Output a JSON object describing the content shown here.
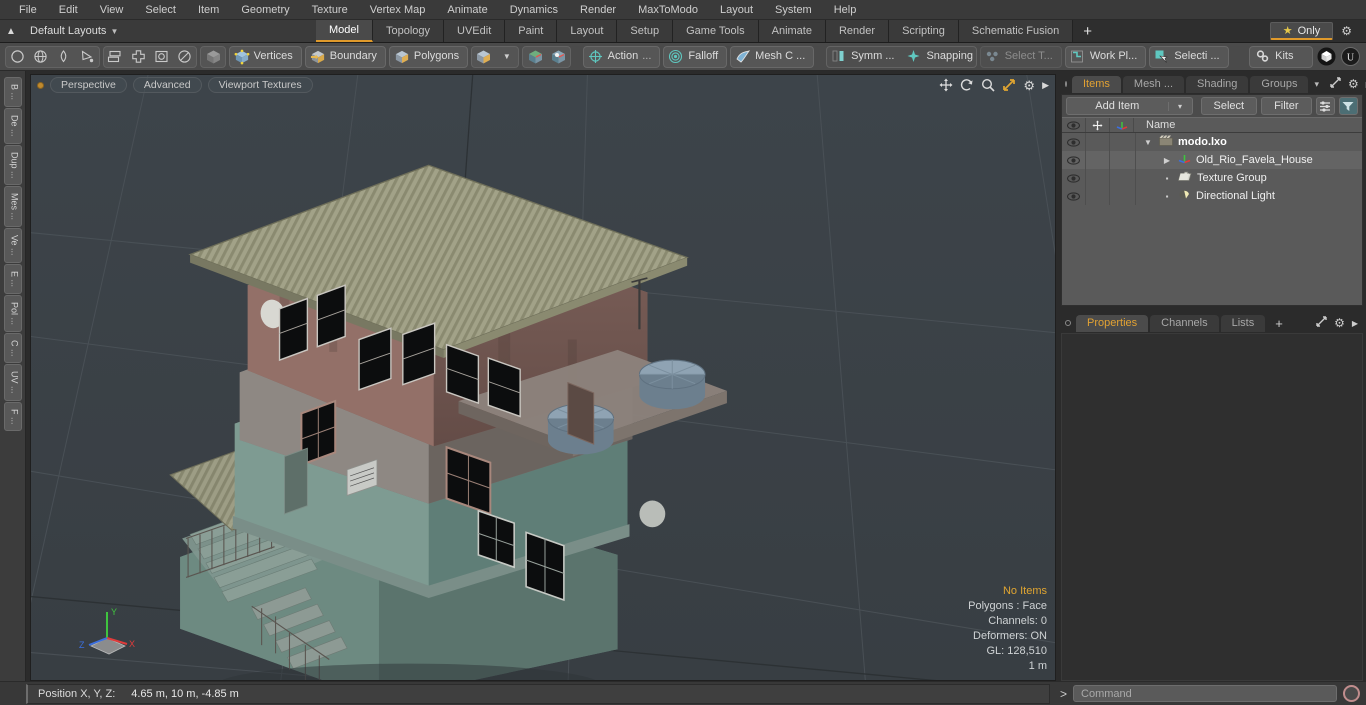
{
  "app": {
    "title": "modo",
    "accent": "#e09a2b",
    "viewport_bg": "#3b4247"
  },
  "menubar": {
    "items": [
      "File",
      "Edit",
      "View",
      "Select",
      "Item",
      "Geometry",
      "Texture",
      "Vertex Map",
      "Animate",
      "Dynamics",
      "Render",
      "MaxToModo",
      "Layout",
      "System",
      "Help"
    ]
  },
  "layoutbar": {
    "layout_name": "Default Layouts",
    "tabs": [
      "Model",
      "Topology",
      "UVEdit",
      "Paint",
      "Layout",
      "Setup",
      "Game Tools",
      "Animate",
      "Render",
      "Scripting",
      "Schematic Fusion"
    ],
    "active_tab": "Model",
    "add_tab_label": "+",
    "only_label": "Only",
    "star_icon": "star-icon",
    "gear_icon": "gear-icon"
  },
  "toolbar": {
    "shape_tools": [
      "circle-icon",
      "globe-icon",
      "pen-icon",
      "curve-icon"
    ],
    "mode_tools": [
      "mirror-icon",
      "plus-shape-icon",
      "square-select-icon",
      "circle-select-icon"
    ],
    "selection_cube": "cube-icon",
    "pills": [
      {
        "label": "Vertices",
        "icon": "vertices-cube-icon",
        "dim": false
      },
      {
        "label": "Boundary",
        "icon": "boundary-cube-icon",
        "dim": false
      },
      {
        "label": "Polygons",
        "icon": "polygons-cube-icon",
        "dim": false
      }
    ],
    "cube_dropdown": {
      "icon": "cube-icon",
      "caret": "▾"
    },
    "axis_tools": [
      "axis-cube-green-icon",
      "axis-cube-red-icon"
    ],
    "action_label": "Action",
    "action_ellipsis": "...",
    "falloff_label": "Falloff",
    "mesh_constraint_label": "Mesh C ...",
    "symmetry_label": "Symm ...",
    "snapping_label": "Snapping",
    "select_through_label": "Select T...",
    "work_plane_label": "Work Pl...",
    "selection_set_label": "Selecti ...",
    "kits_label": "Kits",
    "kit_icons": [
      "modo-badge-icon",
      "unreal-badge-icon"
    ]
  },
  "left_tabs": {
    "items": [
      "B ...",
      "De ...",
      "Dup ...",
      "Mes ...",
      "Ve ...",
      "E ...",
      "Pol ...",
      "C ...",
      "UV ...",
      "F ..."
    ]
  },
  "viewport": {
    "header_buttons": [
      "Perspective",
      "Advanced",
      "Viewport Textures"
    ],
    "header_icons": [
      "move-icon",
      "rotate-icon",
      "zoom-icon",
      "fit-icon",
      "gear-icon",
      "play-arrow-icon"
    ],
    "stats": {
      "no_items": "No Items",
      "polygons": "Polygons : Face",
      "channels": "Channels: 0",
      "deformers": "Deformers: ON",
      "gl": "GL: 128,510",
      "scale": "1 m"
    },
    "axis_gizmo": {
      "x": "X",
      "y": "Y",
      "z": "Z"
    },
    "status_label": "Position X, Y, Z:",
    "status_value": "4.65 m, 10 m, -4.85 m"
  },
  "right_panel": {
    "items_tabs": [
      "Items",
      "Mesh ...",
      "Shading",
      "Groups"
    ],
    "items_active_tab": "Items",
    "items_caret": "▾",
    "toolbar": {
      "add_item": "Add Item",
      "add_item_caret": "▾",
      "select": "Select",
      "filter": "Filter",
      "list_icon": "list-icon",
      "funnel_icon": "funnel-icon"
    },
    "list_header": {
      "eye_icon": "eye-icon",
      "move_icon": "move-cross-icon",
      "axis_icon": "axis-icon",
      "name": "Name"
    },
    "tree": [
      {
        "label": "modo.lxo",
        "icon": "scene-clapper-icon",
        "depth": 0,
        "twisty": "▼",
        "root": true,
        "selected": false
      },
      {
        "label": "Old_Rio_Favela_House",
        "icon": "mesh-axis-icon",
        "depth": 1,
        "twisty": "▶",
        "root": false,
        "selected": true
      },
      {
        "label": "Texture Group",
        "icon": "folder-icon",
        "depth": 1,
        "twisty": "",
        "root": false,
        "selected": false
      },
      {
        "label": "Directional Light",
        "icon": "light-icon",
        "depth": 1,
        "twisty": "",
        "root": false,
        "selected": false
      }
    ],
    "props_tabs": [
      "Properties",
      "Channels",
      "Lists"
    ],
    "props_active_tab": "Properties",
    "props_add_tab": "+"
  },
  "bottom": {
    "position_label": "Position X, Y, Z:",
    "position_value": "4.65 m, 10 m, -4.85 m",
    "prompt": ">",
    "command_placeholder": "Command",
    "record_icon": "record-icon"
  }
}
